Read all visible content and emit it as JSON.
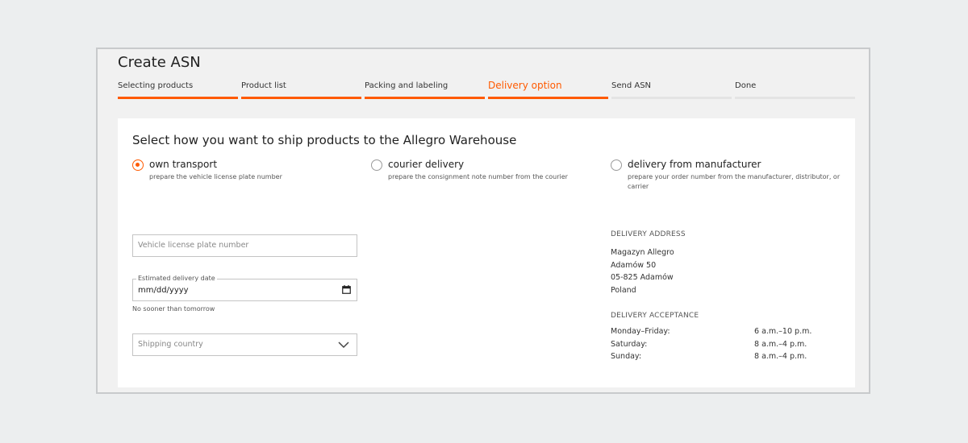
{
  "page": {
    "title": "Create ASN"
  },
  "steps": [
    {
      "label": "Selecting products",
      "state": "done"
    },
    {
      "label": "Product list",
      "state": "done"
    },
    {
      "label": "Packing and labeling",
      "state": "done"
    },
    {
      "label": "Delivery option",
      "state": "active"
    },
    {
      "label": "Send ASN",
      "state": "pending"
    },
    {
      "label": "Done",
      "state": "pending"
    }
  ],
  "colors": {
    "accent": "#ff5a00",
    "inactive_bar": "#e4e4e4"
  },
  "shipping": {
    "heading": "Select how you want to ship products to the Allegro Warehouse",
    "options": [
      {
        "label": "own transport",
        "hint": "prepare the vehicle license plate number",
        "selected": true
      },
      {
        "label": "courier delivery",
        "hint": "prepare the consignment note number from the courier",
        "selected": false
      },
      {
        "label": "delivery from manufacturer",
        "hint": "prepare your order number from the manufacturer, distributor, or carrier",
        "selected": false
      }
    ]
  },
  "form": {
    "plate_placeholder": "Vehicle license plate number",
    "date_label": "Estimated delivery date",
    "date_value": "mm/dd/yyyy",
    "date_helper": "No sooner than tomorrow",
    "country_placeholder": "Shipping country"
  },
  "delivery_address": {
    "heading": "DELIVERY ADDRESS",
    "lines": [
      "Magazyn Allegro",
      "Adamów 50",
      "05-825 Adamów",
      "Poland"
    ]
  },
  "delivery_acceptance": {
    "heading": "DELIVERY ACCEPTANCE",
    "rows": [
      {
        "day": "Monday–Friday:",
        "time": "6 a.m.–10 p.m."
      },
      {
        "day": "Saturday:",
        "time": "8 a.m.–4 p.m."
      },
      {
        "day": "Sunday:",
        "time": "8 a.m.–4 p.m."
      }
    ]
  }
}
